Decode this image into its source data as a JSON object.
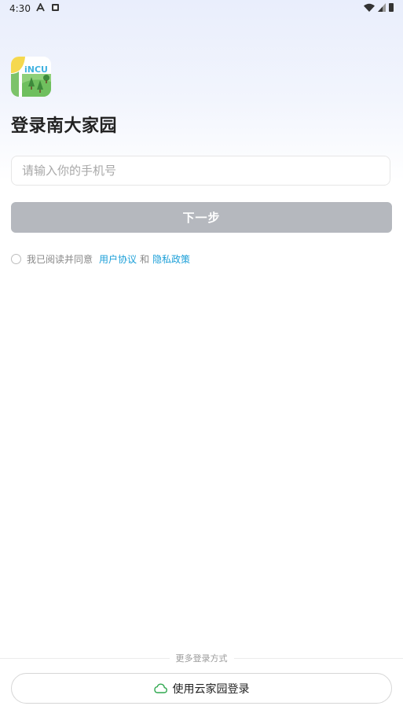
{
  "status_bar": {
    "time": "4:30"
  },
  "header": {
    "logo_text": "iNCU",
    "title": "登录南大家园"
  },
  "form": {
    "phone_placeholder": "请输入你的手机号",
    "next_label": "下一步"
  },
  "agreement": {
    "prefix": "我已阅读并同意",
    "user_agreement": "用户协议",
    "and": "和",
    "privacy_policy": "隐私政策"
  },
  "more_login": {
    "divider_label": "更多登录方式",
    "cloud_login_label": "使用云家园登录"
  },
  "colors": {
    "link": "#1b9fd8",
    "button_disabled": "#b5b8be",
    "cloud_icon": "#2fa84f"
  },
  "icons": [
    "wifi-icon",
    "signal-icon",
    "battery-icon",
    "cloud-icon"
  ]
}
